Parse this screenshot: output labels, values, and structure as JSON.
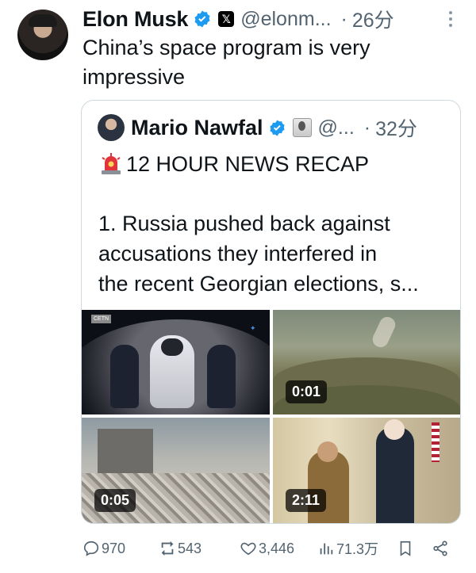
{
  "tweet": {
    "author_name": "Elon Musk",
    "handle": "@elonm...",
    "dot": "·",
    "time": "26分",
    "text": "China’s space program is very\nimpressive"
  },
  "quoted": {
    "author_name": "Mario Nawfal",
    "handle": "@...",
    "dot": "·",
    "time": "32分",
    "headline": "12 HOUR NEWS RECAP",
    "body": "1. Russia pushed back against\naccusations they interfered in\nthe recent Georgian elections, s...",
    "media": [
      {
        "label": "CETN",
        "duration": ""
      },
      {
        "duration": "0:01"
      },
      {
        "duration": "0:05"
      },
      {
        "duration": "2:11"
      }
    ]
  },
  "actions": {
    "replies": "970",
    "reposts": "543",
    "likes": "3,446",
    "views": "71.3万"
  },
  "colors": {
    "text_primary": "#0f1419",
    "text_secondary": "#536471",
    "verified_blue": "#1d9bf0",
    "border": "#cfd9de"
  }
}
